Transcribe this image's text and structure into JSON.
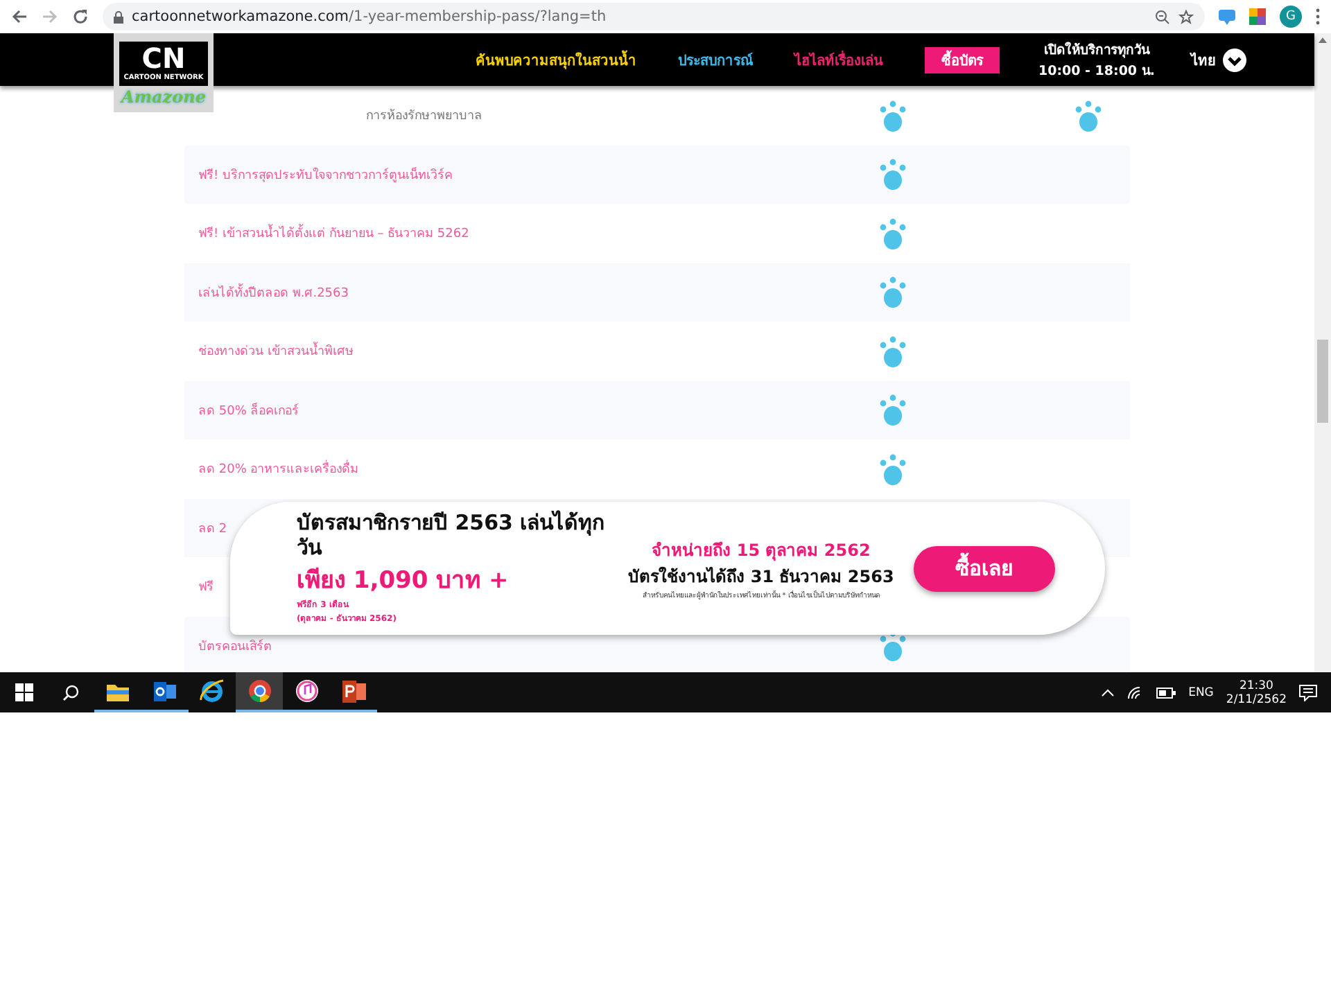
{
  "browser": {
    "url_host": "cartoonnetworkamazone.com",
    "url_path": "/1-year-membership-pass/?lang=th",
    "avatar": "G"
  },
  "logo": {
    "mark": "CN",
    "brand": "CARTOON NETWORK",
    "name": "Amazone"
  },
  "nav": {
    "items": [
      {
        "label": "ค้นพบความสนุกในสวนน้ำ",
        "color": "#f5d000"
      },
      {
        "label": "ประสบการณ์",
        "color": "#3fb6e8"
      },
      {
        "label": "ไฮไลท์เรื่องเล่น",
        "color": "#e8246e"
      }
    ],
    "button": "ซื้อบัตร",
    "hours": [
      "เปิดให้บริการทุกวัน",
      "10:00 - 18:00 น."
    ],
    "language": "ไทย"
  },
  "rows": [
    {
      "label": "การห้องรักษาพยาบาล",
      "paw_2": true,
      "paw_3": true
    },
    {
      "label": "ฟรี! บริการสุดประทับใจจากชาวการ์ตูนเน็ทเวิร์ค",
      "paw_2": true,
      "paw_3": false
    },
    {
      "label": "ฟรี! เข้าสวนน้ำได้ตั้งแต่ กันยายน – ธันวาคม 5262",
      "paw_2": true,
      "paw_3": false
    },
    {
      "label": "เล่นได้ทั้งปีตลอด พ.ศ.2563",
      "paw_2": true,
      "paw_3": false
    },
    {
      "label": "ช่องทางด่วน เข้าสวนน้ำพิเศษ",
      "paw_2": true,
      "paw_3": false
    },
    {
      "label": "ลด 50% ล็อคเกอร์",
      "paw_2": true,
      "paw_3": false
    },
    {
      "label": "ลด 20% อาหารและเครื่องดื่ม",
      "paw_2": true,
      "paw_3": false
    },
    {
      "label": "ลด 2"
    },
    {
      "label": "ฟรี"
    },
    {
      "label": "บัตรคอนเสิร์ต",
      "paw_2": true,
      "paw_3": false
    }
  ],
  "banner": {
    "title": "บัตรสมาชิกรายปี 2563 เล่นได้ทุกวัน",
    "price": "เพียง 1,090 บาท +",
    "bonus": "ฟรีอีก 3 เดือน",
    "bonus_period": "(ตุลาคม - ธันวาคม 2562)",
    "sale": "จำหน่ายถึง 15 ตุลาคม 2562",
    "valid": "บัตรใช้งานได้ถึง 31 ธันวาคม 2563",
    "note": "สำหรับคนไทยและผู้พำนักในประเทศไทยเท่านั้น * เงื่อนไขเป็นไปตามบริษัทกำหนด",
    "button": "ซื้อเลย"
  },
  "taskbar": {
    "apps": [
      {
        "kind": "explorer",
        "open": true,
        "selected": false
      },
      {
        "kind": "outlook",
        "open": true,
        "selected": false
      },
      {
        "kind": "ie",
        "open": false,
        "selected": false
      },
      {
        "kind": "chrome",
        "open": true,
        "selected": true
      },
      {
        "kind": "music",
        "open": true,
        "selected": false
      },
      {
        "kind": "powerpoint",
        "open": true,
        "selected": false
      }
    ],
    "language": "ENG",
    "time": "21:30",
    "date": "2/11/2562"
  }
}
